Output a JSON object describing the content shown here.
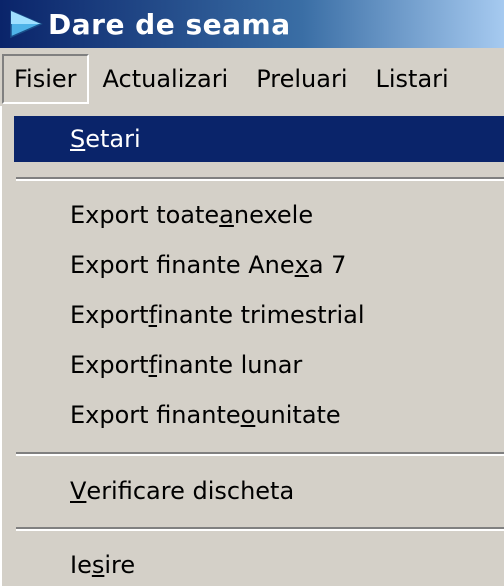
{
  "window": {
    "title": "Dare de seama",
    "icon": "app-arrow-icon"
  },
  "menubar": {
    "items": [
      {
        "label": "Fisier"
      },
      {
        "label": "Actualizari"
      },
      {
        "label": "Preluari"
      },
      {
        "label": "Listari"
      }
    ]
  },
  "dropdown": {
    "items": [
      {
        "label": "Setari",
        "mnemonic": "S",
        "rest": "etari",
        "selected": true
      },
      {
        "before": "Export toate ",
        "mnemonic": "a",
        "after": "nexele"
      },
      {
        "before": "Export finante Ane",
        "mnemonic": "x",
        "after": "a 7"
      },
      {
        "before": "Export ",
        "mnemonic": "f",
        "after": "inante trimestrial"
      },
      {
        "before": "Export ",
        "mnemonic": "f",
        "after": "inante lunar"
      },
      {
        "before": "Export finante ",
        "mnemonic": "o",
        "after": " unitate"
      },
      {
        "before": "",
        "mnemonic": "V",
        "after": "erificare discheta"
      },
      {
        "before": "Ie",
        "mnemonic": "s",
        "after": "ire"
      }
    ]
  }
}
